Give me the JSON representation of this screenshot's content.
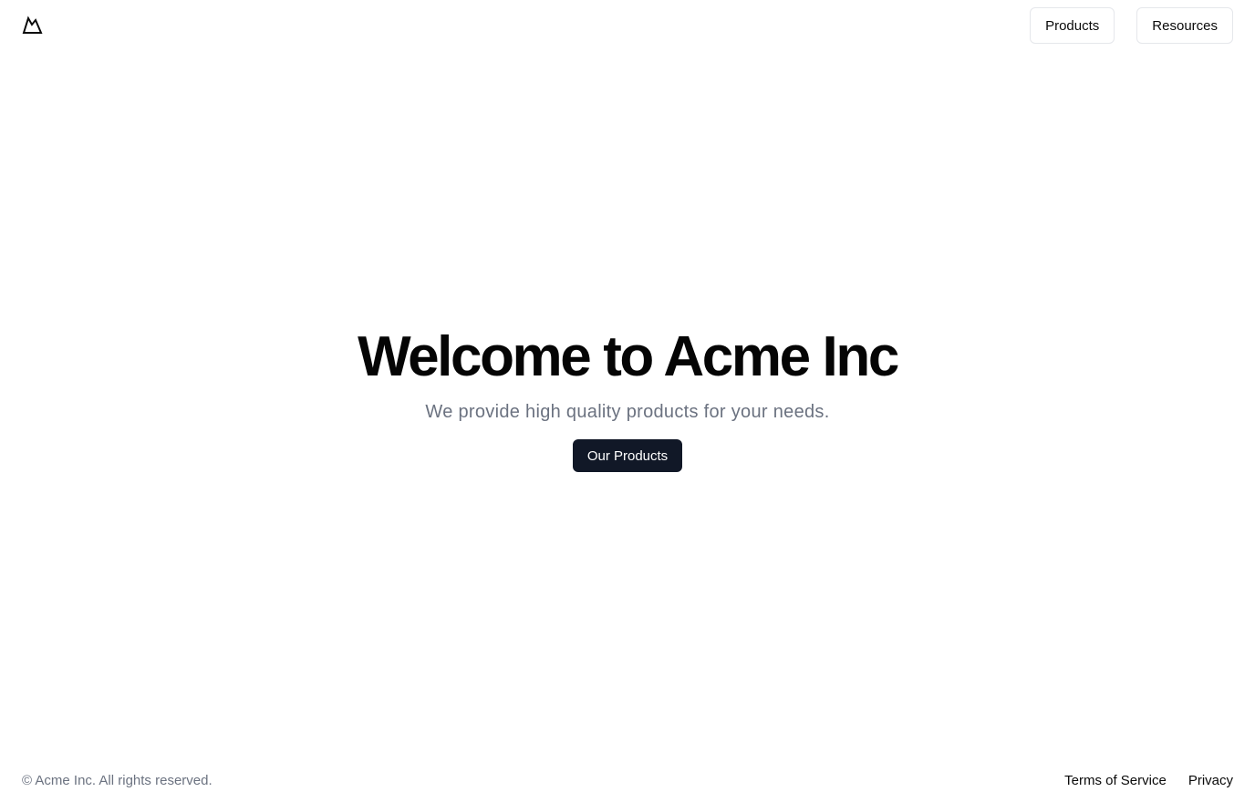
{
  "header": {
    "logo_icon": "mountain-icon",
    "nav": [
      {
        "label": "Products"
      },
      {
        "label": "Resources"
      }
    ]
  },
  "hero": {
    "title": "Welcome to Acme Inc",
    "subtitle": "We provide high quality products for your needs.",
    "cta_label": "Our Products"
  },
  "footer": {
    "copyright": "© Acme Inc. All rights reserved.",
    "links": [
      {
        "label": "Terms of Service"
      },
      {
        "label": "Privacy"
      }
    ]
  },
  "colors": {
    "primary_button": "#111827",
    "muted_text": "#6b7280",
    "border": "#e5e7eb"
  }
}
